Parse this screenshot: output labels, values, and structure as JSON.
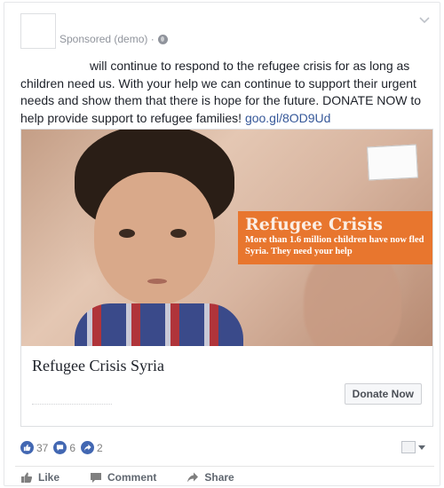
{
  "post": {
    "sponsored_label": "Sponsored (demo) ·",
    "text_lead": "will continue to respond to the refugee crisis for as long as children need us. With your help we can continue to support their urgent needs and show them that there is hope for the future. DONATE NOW to help provide support to refugee families!",
    "link": "goo.gl/8OD9Ud"
  },
  "ad": {
    "overlay_title": "Refugee Crisis",
    "overlay_subtitle": "More than 1.6 million children have now fled Syria. They need your help",
    "headline": "Refugee Crisis Syria",
    "cta": "Donate Now"
  },
  "reactions": {
    "likes": "37",
    "comments": "6",
    "shares": "2"
  },
  "actions": {
    "like": "Like",
    "comment": "Comment",
    "share": "Share"
  },
  "colors": {
    "link": "#365899",
    "overlay": "#e8762e",
    "reaction_blue": "#4267b2"
  },
  "icons": [
    "globe-icon",
    "chevron-down-icon",
    "like-icon",
    "comment-icon",
    "share-icon",
    "seen-icon"
  ]
}
